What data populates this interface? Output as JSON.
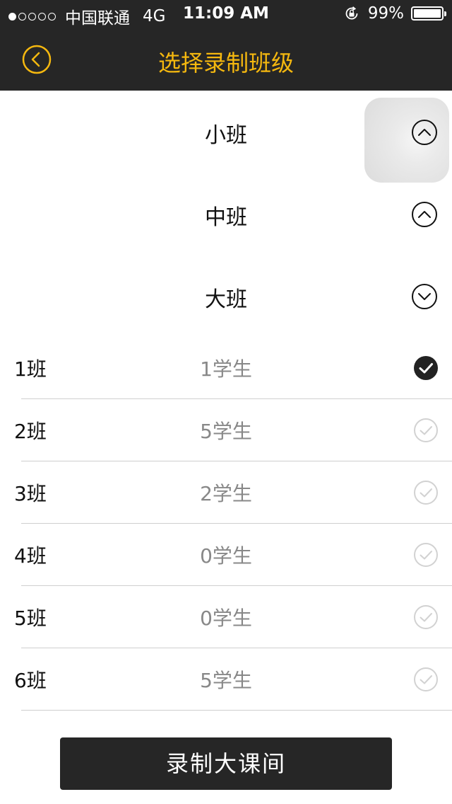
{
  "status_bar": {
    "carrier": "中国联通",
    "network": "4G",
    "time": "11:09 AM",
    "battery": "99%",
    "battery_level": 0.99,
    "signal_bars_filled": 1,
    "signal_bars_total": 5
  },
  "nav": {
    "title": "选择录制班级",
    "back_icon": "chevron-left-circle-icon",
    "accent_color": "#f5b80f",
    "bar_color": "#262626"
  },
  "groups": [
    {
      "label": "小班",
      "toggle_icon": "chevron-up-circle-icon"
    },
    {
      "label": "中班",
      "toggle_icon": "chevron-up-circle-icon"
    },
    {
      "label": "大班",
      "toggle_icon": "chevron-down-circle-icon"
    }
  ],
  "classes": [
    {
      "name": "1班",
      "students": "1学生",
      "selected": true
    },
    {
      "name": "2班",
      "students": "5学生",
      "selected": false
    },
    {
      "name": "3班",
      "students": "2学生",
      "selected": false
    },
    {
      "name": "4班",
      "students": "0学生",
      "selected": false
    },
    {
      "name": "5班",
      "students": "0学生",
      "selected": false
    },
    {
      "name": "6班",
      "students": "5学生",
      "selected": false
    }
  ],
  "record_button": {
    "label": "录制大课间"
  }
}
